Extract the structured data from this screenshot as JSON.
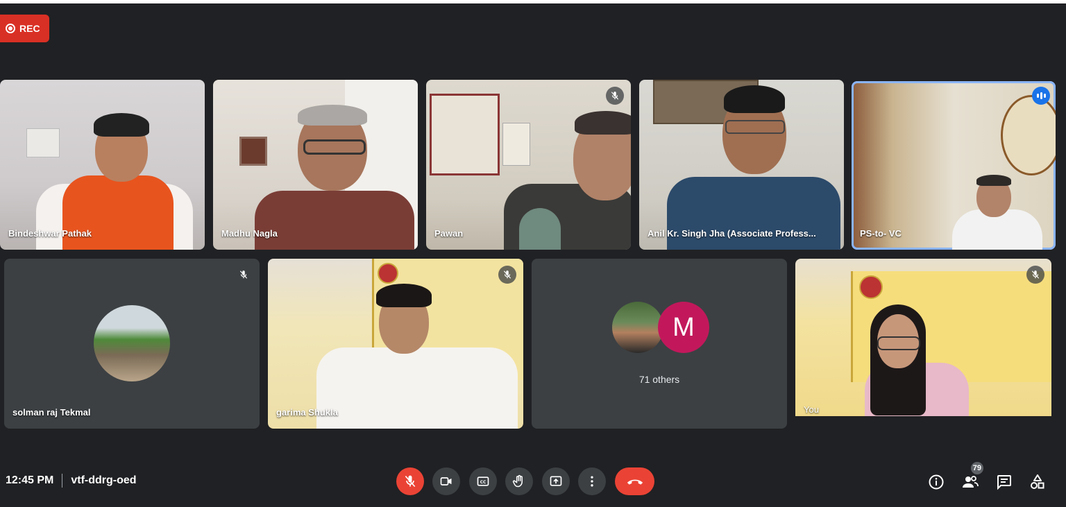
{
  "recording": {
    "label": "REC"
  },
  "participants": [
    {
      "name": "Bindeshwar Pathak"
    },
    {
      "name": "Madhu Nagla"
    },
    {
      "name": "Pawan"
    },
    {
      "name": "Anil Kr. Singh Jha (Associate Profess..."
    },
    {
      "name": "PS-to- VC"
    },
    {
      "name": "solman raj Tekmal"
    },
    {
      "name": "garima Shukla"
    },
    {
      "name": "You"
    }
  ],
  "others": {
    "label": "71 others",
    "avatar_letter": "M",
    "avatar_color": "#c2185b"
  },
  "meeting": {
    "time": "12:45 PM",
    "code": "vtf-ddrg-oed"
  },
  "people_count": "79",
  "colors": {
    "background": "#202124",
    "tile": "#3c4043",
    "red": "#ea4335",
    "active_border": "#8ab4f8",
    "speaking": "#1a73e8"
  },
  "icons": {
    "record": "record-icon",
    "mic_off": "mic-off-icon",
    "camera": "camera-icon",
    "captions": "captions-icon",
    "raise_hand": "raise-hand-icon",
    "present": "present-icon",
    "more": "more-options-icon",
    "end_call": "end-call-icon",
    "info": "info-icon",
    "people": "people-icon",
    "chat": "chat-icon",
    "activities": "activities-icon"
  }
}
